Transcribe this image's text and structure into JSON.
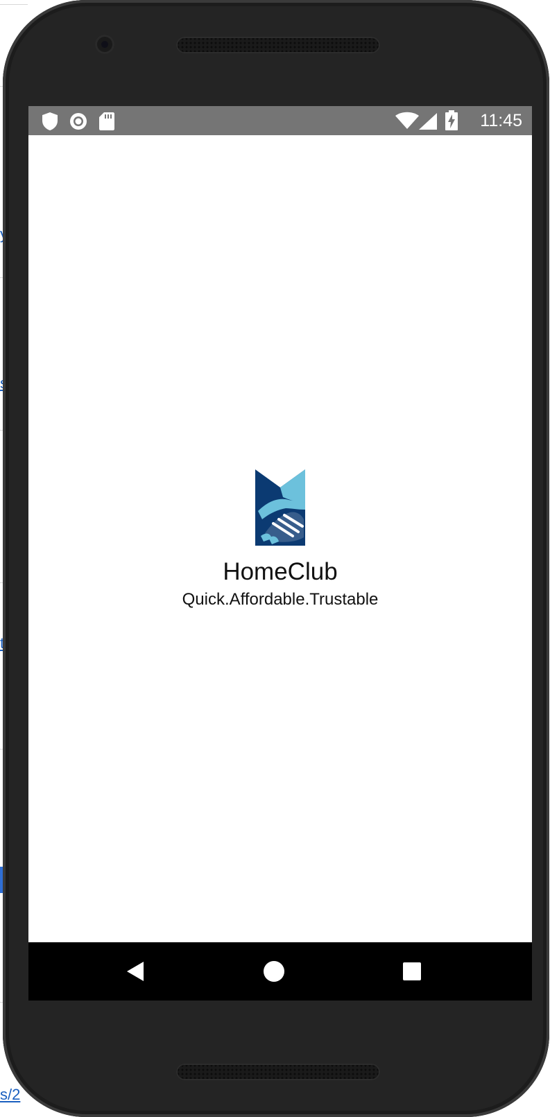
{
  "status_bar": {
    "time": "11:45",
    "left_icons": [
      "shield-icon",
      "circle-record-icon",
      "sd-card-icon"
    ],
    "right_icons": [
      "wifi-icon",
      "cell-signal-icon",
      "battery-charging-icon"
    ]
  },
  "app": {
    "title": "HomeClub",
    "tagline": "Quick.Affordable.Trustable",
    "logo_icon": "handshake-logo-icon"
  },
  "navigation_bar": {
    "buttons": [
      "back-icon",
      "home-icon",
      "recents-icon"
    ]
  },
  "colors": {
    "status_bar": "#757575",
    "navigation_bar": "#000000",
    "logo_dark_blue": "#0b3a72",
    "logo_light_blue": "#6cc1dc",
    "phone_frame": "#242424"
  },
  "background_page": {
    "link_fragments": [
      "y",
      "s",
      "t",
      "s/2"
    ]
  }
}
